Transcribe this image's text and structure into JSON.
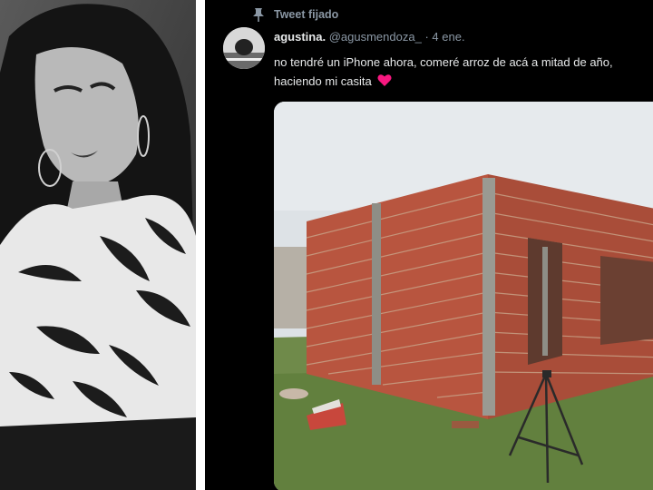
{
  "tweet": {
    "pinned_label": "Tweet fijado",
    "display_name": "agustina.",
    "handle": "@agusmendoza_",
    "separator": "·",
    "date": "4 ene.",
    "text_line1": "no tendré un iPhone ahora, comeré arroz de acá a mitad de año,",
    "text_line2": "haciendo mi casita"
  },
  "icons": {
    "pin": "pin-icon",
    "heart": "heart-icon"
  },
  "colors": {
    "background": "#000000",
    "text": "#e7e9ea",
    "secondary": "#8b98a5",
    "heart": "#f91880"
  }
}
